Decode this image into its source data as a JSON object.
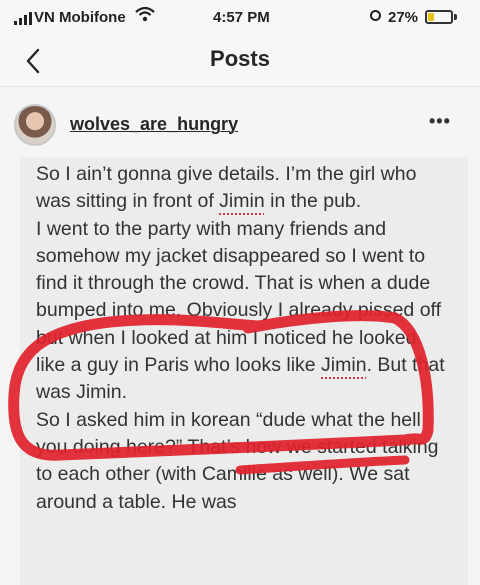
{
  "status_bar": {
    "carrier": "VN Mobifone",
    "time": "4:57 PM",
    "battery": "27%",
    "battery_level": 0.27
  },
  "nav": {
    "title": "Posts"
  },
  "post": {
    "username": "wolves_are_hungry",
    "more_label": "•••",
    "caption_parts": {
      "p1": "So I ain’t gonna give details. I’m the girl who was sitting in front of ",
      "jimin1": "Jimin",
      "p2": " in the pub.\nI went to the party with many friends and somehow my jacket disappeared so I went to find it through the crowd. That is when a dude bumped into me. Obviously I already pissed off but when I looked at him I noticed he looked like a guy in Paris who looks like ",
      "jimin2": "Jimin",
      "p3": ". But that was Jimin.\nSo I asked him in korean “dude what the hell you doing here?” That’s how we started talking to each other (with Camille as well). We sat around a table. He was"
    }
  },
  "colors": {
    "annotation": "#e0222b",
    "underline": "#d9333f"
  }
}
